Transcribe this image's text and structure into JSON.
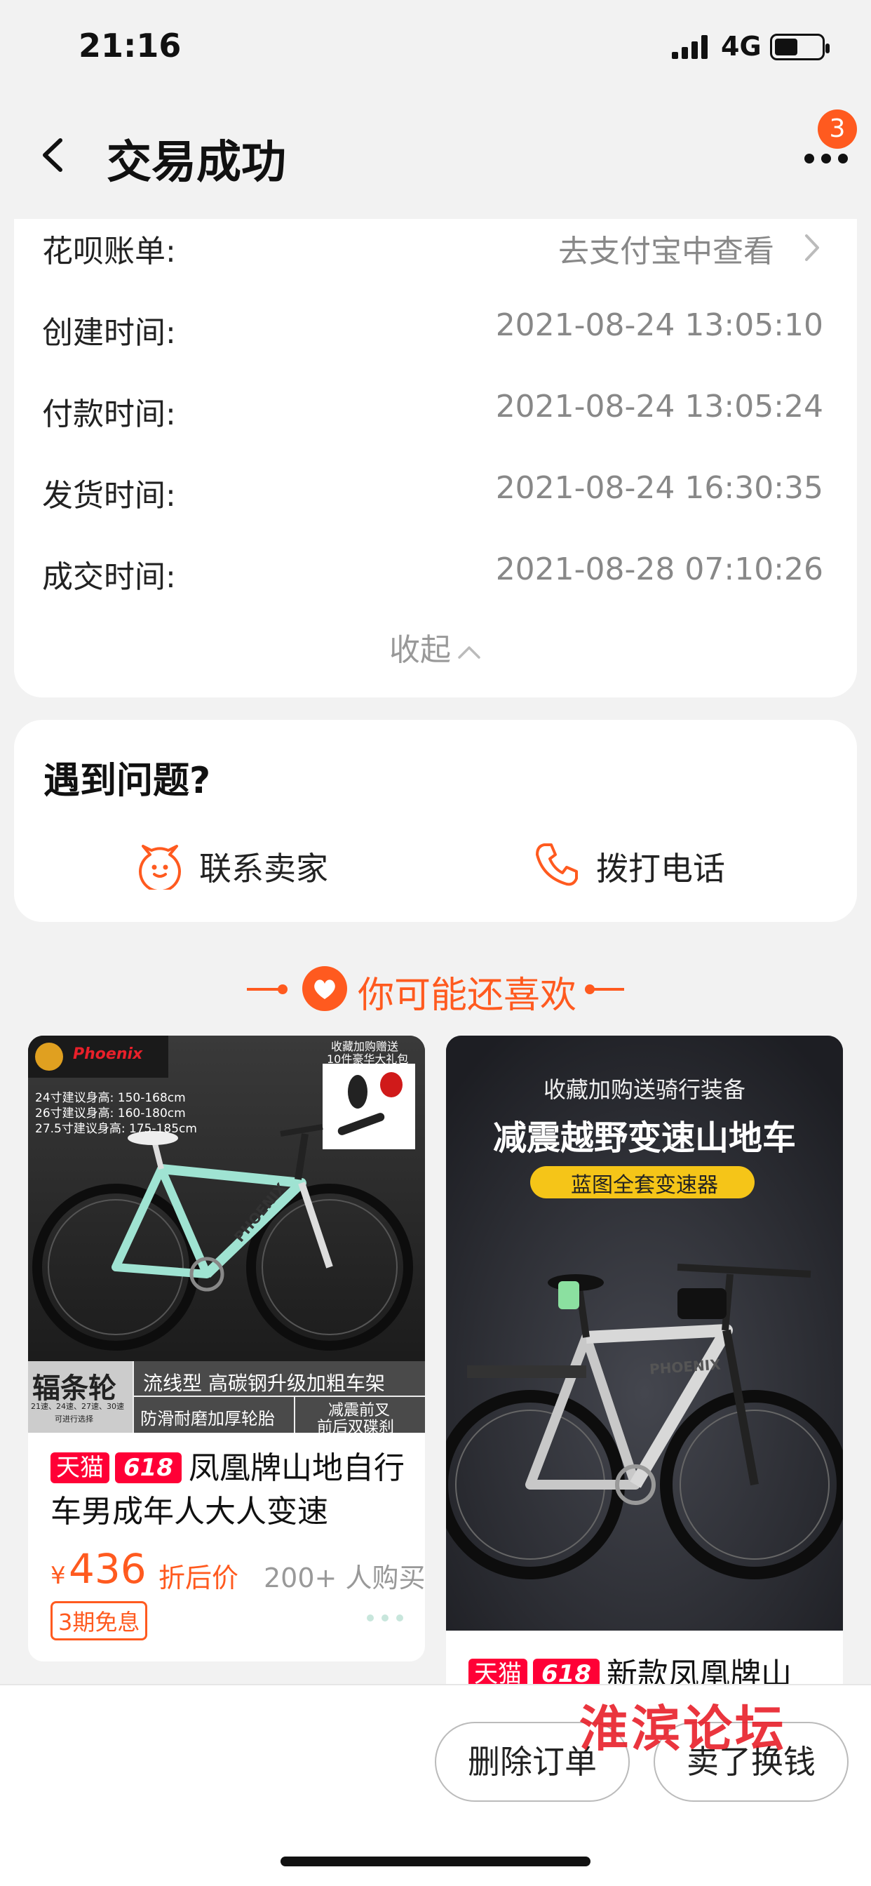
{
  "status_bar": {
    "time": "21:16",
    "network": "4G"
  },
  "nav": {
    "title": "交易成功",
    "badge_count": "3"
  },
  "order_info": [
    {
      "label": "花呗账单:",
      "value": "去支付宝中查看",
      "is_link": true
    },
    {
      "label": "创建时间:",
      "value": "2021-08-24 13:05:10"
    },
    {
      "label": "付款时间:",
      "value": "2021-08-24 13:05:24"
    },
    {
      "label": "发货时间:",
      "value": "2021-08-24 16:30:35"
    },
    {
      "label": "成交时间:",
      "value": "2021-08-28 07:10:26"
    }
  ],
  "collapse_label": "收起",
  "help": {
    "title": "遇到问题?",
    "contact_seller": "联系卖家",
    "call_phone": "拨打电话"
  },
  "recommend": {
    "title": "你可能还喜欢"
  },
  "products": [
    {
      "tag_tmall": "天猫",
      "tag_618": "618",
      "title": "凤凰牌山地自行车男成年人大人变速",
      "currency": "¥",
      "price": "436",
      "price_type": "折后价",
      "buy_count": "200+ 人购买",
      "installment": "3期免息",
      "image": {
        "brand": "Phoenix",
        "gift_line1": "收藏加购赠送",
        "gift_line2": "10件豪华大礼包",
        "size1": "24寸建议身高: 150-168cm",
        "size2": "26寸建议身高: 160-180cm",
        "size3": "27.5寸建议身高: 175-185cm",
        "frame_text": "PHOENIX",
        "spoke": "辐条轮",
        "speeds": "21速、24速、27速、30速",
        "speeds2": "可进行选择",
        "feature1": "流线型  高碳钢升级加粗车架",
        "feature2": "防滑耐磨加厚轮胎",
        "feature3": "减震前叉",
        "feature4": "前后双碟刹"
      }
    },
    {
      "tag_tmall": "天猫",
      "tag_618": "618",
      "title": "新款凤凰牌山",
      "image": {
        "line1": "收藏加购送骑行装备",
        "line2": "减震越野变速山地车",
        "line3": "蓝图全套变速器",
        "frame_text": "PHOENIX"
      }
    }
  ],
  "actions": {
    "delete": "删除订单",
    "sell": "卖了换钱"
  },
  "watermark": "淮滨论坛",
  "colors": {
    "accent": "#ff5a1f",
    "tmall": "#ff0036",
    "bike_mint": "#9fe3d2"
  }
}
